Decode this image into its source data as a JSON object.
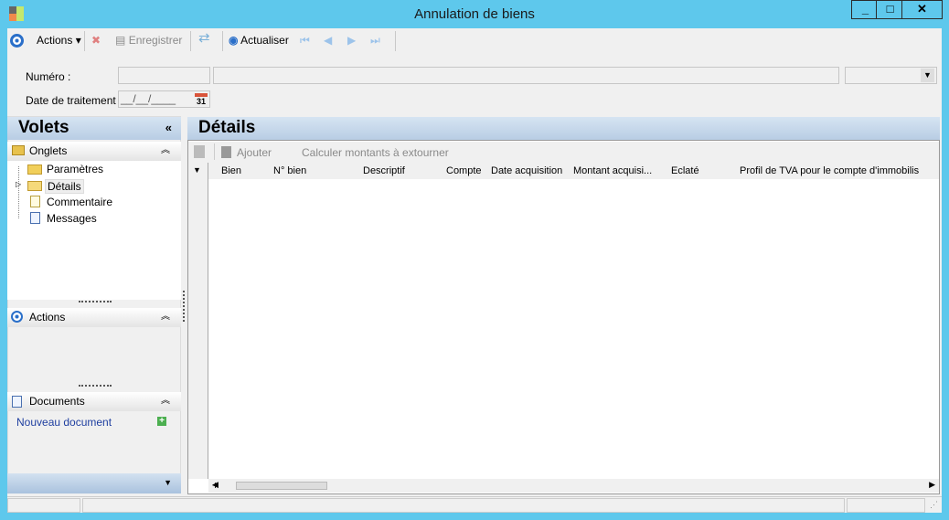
{
  "window": {
    "title": "Annulation de biens",
    "controls": [
      "_",
      "□",
      "✕"
    ]
  },
  "toolbar": {
    "actions": "Actions",
    "save": "Enregistrer",
    "refresh": "Actualiser"
  },
  "form": {
    "numero_label": "Numéro :",
    "date_label": "Date de traitement :",
    "date_value": "__/__/____",
    "calendar_day": "31"
  },
  "left": {
    "title": "Volets",
    "collapse": "«",
    "onglets": "Onglets",
    "items": [
      "Paramètres",
      "Détails",
      "Commentaire",
      "Messages"
    ],
    "actions": "Actions",
    "documents": "Documents",
    "new_document": "Nouveau document"
  },
  "main": {
    "title": "Détails",
    "add": "Ajouter",
    "compute": "Calculer montants à extourner",
    "columns": [
      "Bien",
      "N° bien",
      "Descriptif",
      "Compte",
      "Date acquisition",
      "Montant acquisi...",
      "Eclaté",
      "Profil de TVA pour le compte d'immobilis"
    ]
  },
  "colors": {
    "frame": "#5ec8ec",
    "panel_header": "#c4d6ea",
    "link": "#1f3fa0"
  }
}
